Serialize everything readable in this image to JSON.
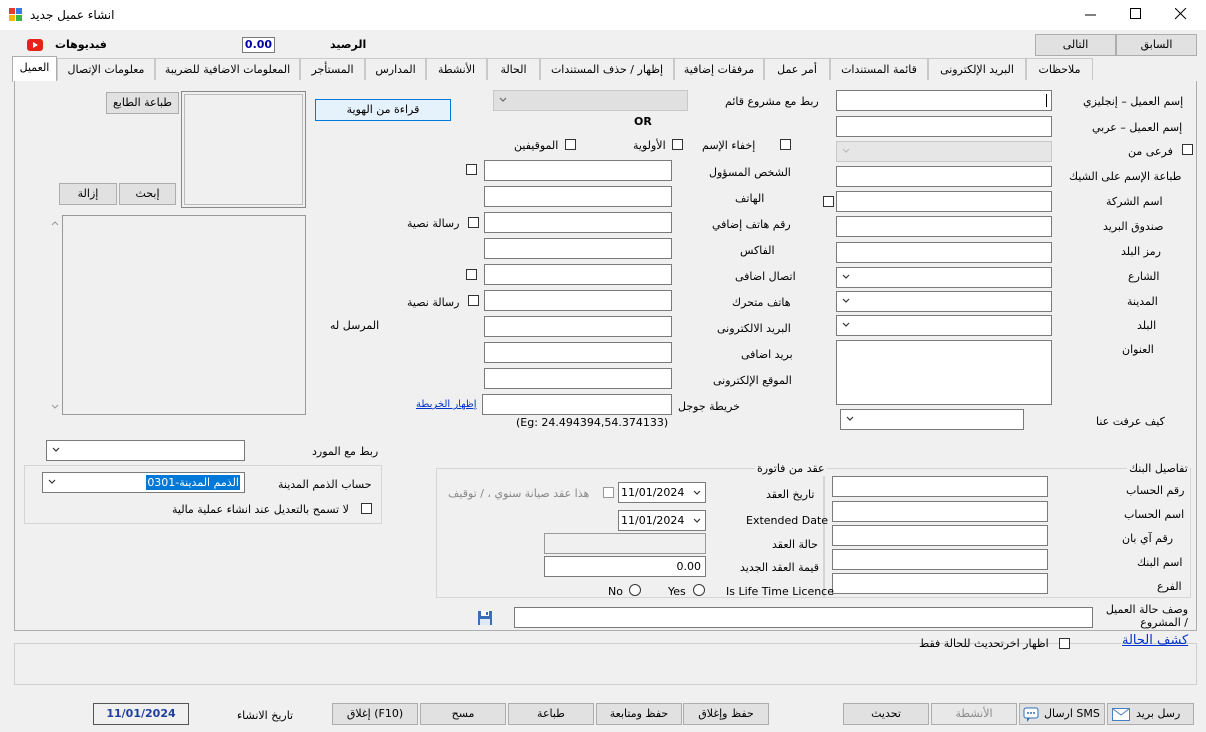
{
  "window": {
    "title": "انشاء عميل جديد",
    "controls": [
      "minimize",
      "maximize",
      "close"
    ]
  },
  "top": {
    "videos_label": "فيديوهات",
    "balance_label": "الرصيد",
    "balance_value": "0.00",
    "next_button": "التالى",
    "prev_button": "السابق"
  },
  "tabs": [
    "العميل",
    "معلومات الإتصال",
    "المعلومات الاضافية للضريبة",
    "المستأجر",
    "المدارس",
    "الأنشطة",
    "الحالة",
    "إظهار / حذف المستندات",
    "مرفقات إضافية",
    "أمر عمل",
    "قائمة المستندات",
    "البريد الإلكترونى",
    "ملاحظات"
  ],
  "right_col": {
    "name_en": "إسم العميل – إنجليزي",
    "name_en_value": "",
    "name_ar": "إسم العميل – عربي",
    "branch_of": "فرعى من",
    "check_print_name": "طباعة الإسم على الشيك",
    "company_name": "اسم الشركة",
    "po_box": "صندوق البريد",
    "country_code": "رمز البلد",
    "street": "الشارع",
    "city": "المدينة",
    "country": "البلد",
    "address": "العنوان",
    "how_known": "كيف عرفت عنا"
  },
  "mid_col": {
    "link_project": "ربط مع مشروع قائم",
    "read_id_button": "قراءة من الهوية",
    "or_label": "OR",
    "hide_name": "إخفاء الإسم",
    "priority": "الأولوية",
    "employees": "الموقيفين",
    "contact_person": "الشخص المسؤول",
    "phone": "الهاتف",
    "extra_phone": "رقم هاتف إضافي",
    "fax": "الفاكس",
    "extra_contact": "اتصال اضافى",
    "mobile": "هاتف متحرك",
    "email": "البريد الالكترونى",
    "extra_email": "بريد اضافى",
    "website": "الموقع الإلكترونى",
    "google_map": "خريطة جوجل",
    "show_map": "إظهار الخريطة",
    "map_example": "(Eg: 24.494394,54.374133)",
    "sms1": "رسالة نصية",
    "sms2": "رسالة نصية"
  },
  "left_col": {
    "print_printer": "طباعة الطابع",
    "search_button": "إبحث",
    "remove_button": "إزالة",
    "sent_to": "المرسل له",
    "link_supplier": "ربط مع المورد",
    "receivables_account": "حساب الذمم المدينة",
    "receivables_value": "0301-الذمم المدينة",
    "no_edit_on_txn": "لا تسمح بالتعديل عند انشاء عملية مالية"
  },
  "bank": {
    "title": "تفاصيل البنك",
    "account_no": "رقم الحساب",
    "account_name": "اسم الحساب",
    "iban": "رقم آي بان",
    "bank_name": "اسم البنك",
    "branch": "الفرع"
  },
  "contract": {
    "title": "عقد من فاتورة",
    "contract_date": "تاريخ العقد",
    "contract_date_value": "11/01/2024",
    "maintenance_check": "هذا عقد صيانة سنوي ، / توقيف",
    "extended_date": "Extended Date",
    "extended_date_value": "11/01/2024",
    "contract_status": "حالة العقد",
    "new_value": "قيمة العقد الجديد",
    "new_value_amount": "0.00",
    "lifetime": "Is Life Time Licence",
    "yes": "Yes",
    "no": "No"
  },
  "status": {
    "desc_label": "وصف حالة العميل / المشروع",
    "status_report": "كشف الحالة",
    "latest_only": "اظهار اخرتحديث للحالة فقط"
  },
  "bottom": {
    "send_mail": "رسل بريد",
    "send_sms": "ارسال SMS",
    "activities": "الأنشطة",
    "update": "تحديث",
    "save_close": "حفظ وإغلاق",
    "save_continue": "حفظ ومتابعة",
    "print": "طباعة",
    "clear": "مسح",
    "close": "إغلاق (F10)",
    "created_label": "تاريخ الانشاء",
    "created_value": "11/01/2024"
  },
  "colors": {
    "accent_blue": "#0033cc",
    "youtube_red": "#e62117",
    "selection_blue": "#0078d7"
  }
}
